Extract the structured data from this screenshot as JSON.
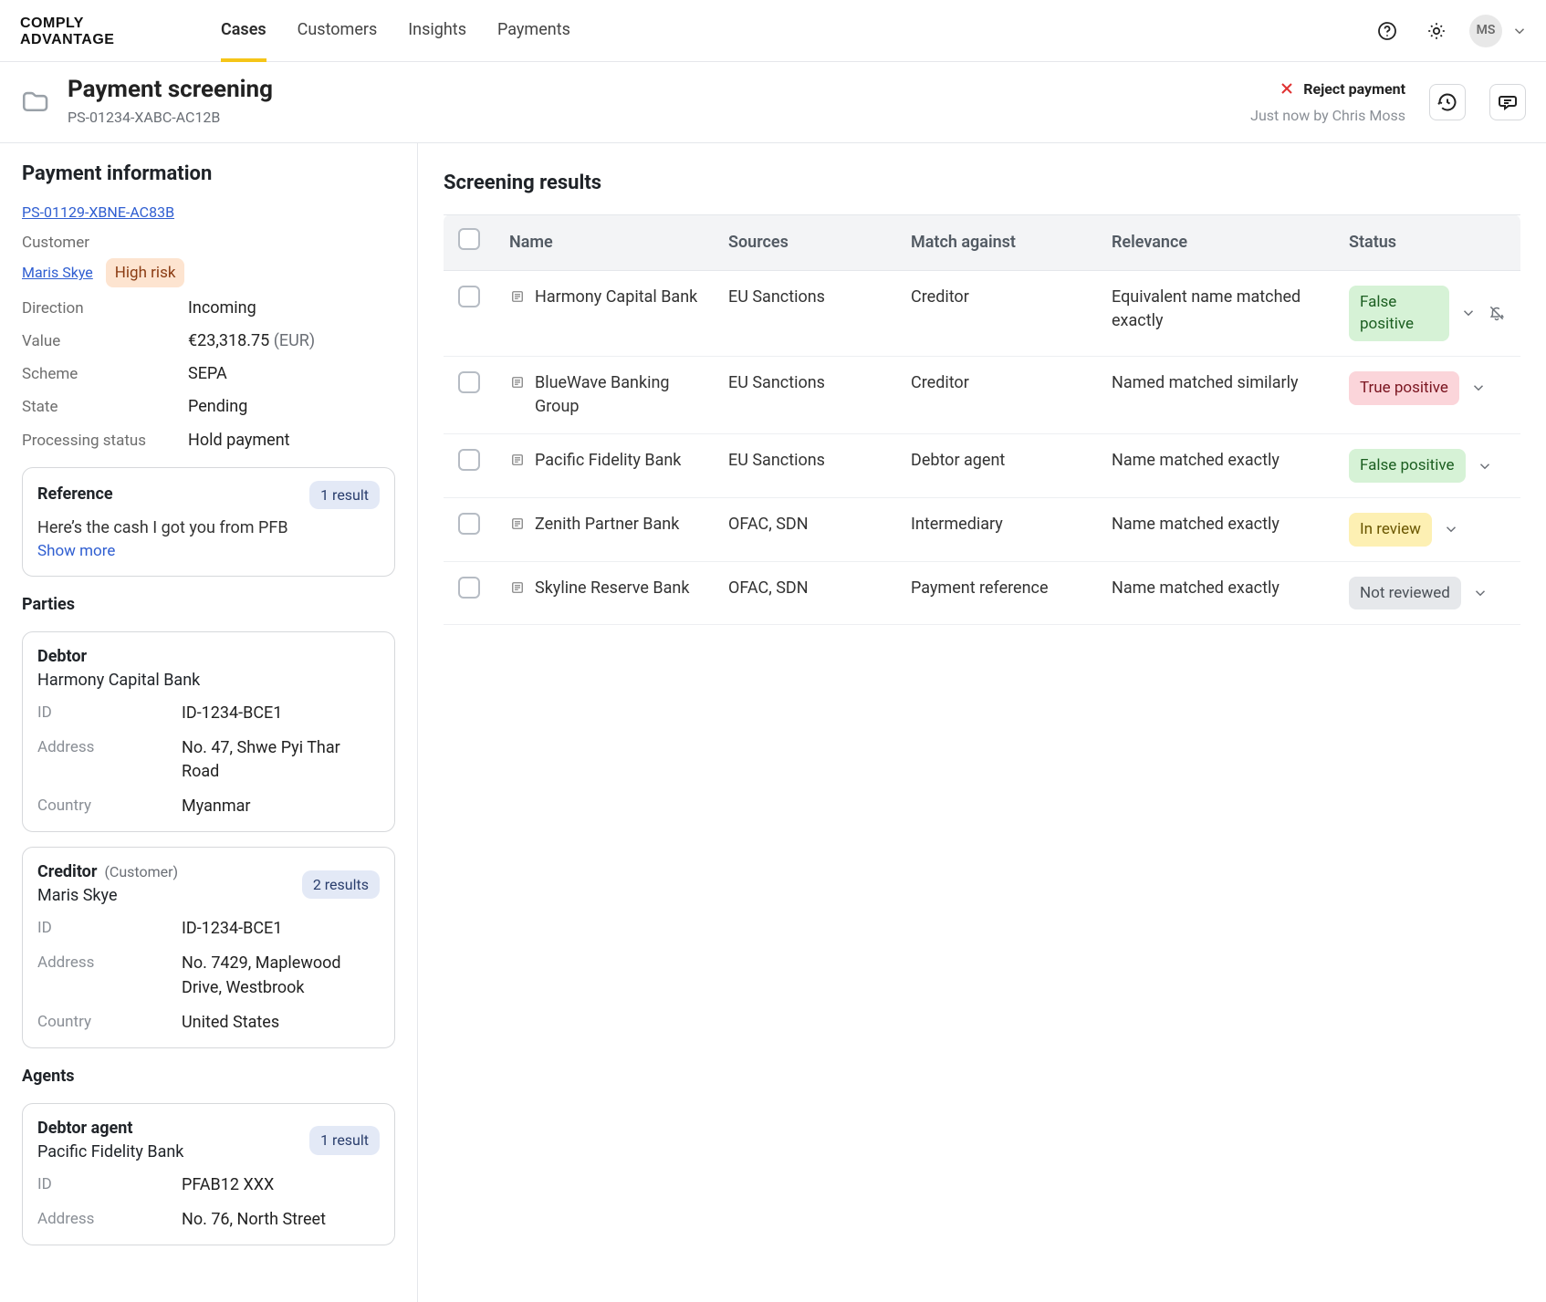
{
  "brand": {
    "name": "COMPLY ADVANTAGE"
  },
  "nav": {
    "tabs": [
      "Cases",
      "Customers",
      "Insights",
      "Payments"
    ],
    "active_index": 0
  },
  "user": {
    "initials": "MS"
  },
  "header": {
    "title": "Payment screening",
    "subtitle": "PS-01234-XABC-AC12B",
    "reject_label": "Reject payment",
    "byline": "Just now by Chris Moss"
  },
  "sidebar": {
    "section_title": "Payment information",
    "linked_id": "PS-01129-XBNE-AC83B",
    "customer_label": "Customer",
    "customer_name": "Maris Skye",
    "risk_label": "High risk",
    "fields": {
      "direction": {
        "label": "Direction",
        "value": "Incoming"
      },
      "value": {
        "label": "Value",
        "value": "€23,318.75",
        "suffix": "(EUR)"
      },
      "scheme": {
        "label": "Scheme",
        "value": "SEPA"
      },
      "state": {
        "label": "State",
        "value": "Pending"
      },
      "processing": {
        "label": "Processing status",
        "value": "Hold payment"
      }
    },
    "reference": {
      "title": "Reference",
      "pill": "1 result",
      "text": "Here’s the cash I got you from PFB",
      "show_more": "Show more"
    },
    "parties_title": "Parties",
    "parties": [
      {
        "role": "Debtor",
        "role_suffix": "",
        "name": "Harmony Capital Bank",
        "results": "",
        "id": "ID-1234-BCE1",
        "address": "No. 47, Shwe Pyi Thar Road",
        "country": "Myanmar"
      },
      {
        "role": "Creditor",
        "role_suffix": "(Customer)",
        "name": "Maris Skye",
        "results": "2 results",
        "id": "ID-1234-BCE1",
        "address": "No. 7429, Maplewood Drive, Westbrook",
        "country": "United States"
      }
    ],
    "agents_title": "Agents",
    "agents": [
      {
        "role": "Debtor agent",
        "name": "Pacific Fidelity Bank",
        "results": "1 result",
        "id": "PFAB12 XXX",
        "address": "No. 76, North Street"
      }
    ],
    "labels": {
      "id": "ID",
      "address": "Address",
      "country": "Country"
    }
  },
  "results": {
    "title": "Screening results",
    "columns": {
      "name": "Name",
      "sources": "Sources",
      "match": "Match against",
      "relevance": "Relevance",
      "status": "Status"
    },
    "rows": [
      {
        "name": "Harmony Capital Bank",
        "sources": "EU Sanctions",
        "match": "Creditor",
        "relevance": "Equivalent name matched exactly",
        "status": {
          "text": "False positive",
          "tone": "green"
        },
        "bell_off": true
      },
      {
        "name": "BlueWave Banking Group",
        "sources": "EU Sanctions",
        "match": "Creditor",
        "relevance": "Named matched similarly",
        "status": {
          "text": "True positive",
          "tone": "red"
        },
        "bell_off": false
      },
      {
        "name": "Pacific Fidelity Bank",
        "sources": "EU Sanctions",
        "match": "Debtor agent",
        "relevance": "Name matched exactly",
        "status": {
          "text": "False positive",
          "tone": "green"
        },
        "bell_off": false
      },
      {
        "name": "Zenith Partner Bank",
        "sources": "OFAC, SDN",
        "match": "Intermediary",
        "relevance": "Name matched exactly",
        "status": {
          "text": "In review",
          "tone": "yellow"
        },
        "bell_off": false
      },
      {
        "name": "Skyline Reserve Bank",
        "sources": "OFAC, SDN",
        "match": "Payment reference",
        "relevance": "Name matched exactly",
        "status": {
          "text": "Not reviewed",
          "tone": "grey"
        },
        "bell_off": false
      }
    ]
  }
}
